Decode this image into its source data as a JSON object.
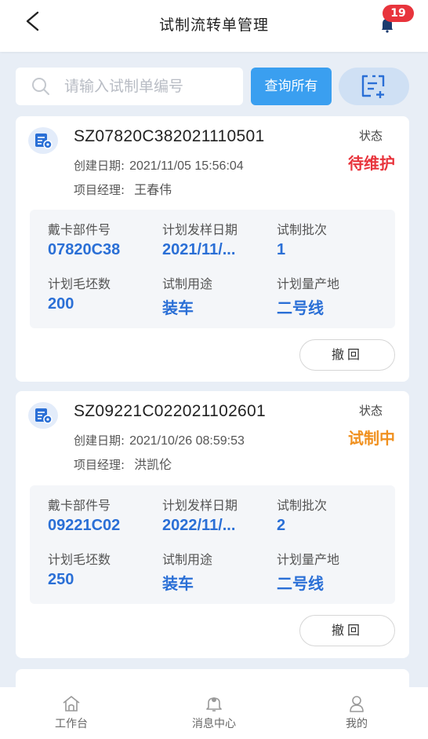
{
  "header": {
    "title": "试制流转单管理",
    "notification_count": "19"
  },
  "search": {
    "placeholder": "请输入试制单编号",
    "value": "",
    "query_all_label": "查询所有"
  },
  "colors": {
    "primary_blue": "#3a9ff0",
    "value_blue": "#2a6fd6",
    "status_pending": "#e8343c",
    "status_in_progress": "#f0901e",
    "badge_red": "#e8343c"
  },
  "labels": {
    "status": "状态",
    "created_date": "创建日期:",
    "project_manager": "项目经理:",
    "part_no": "戴卡部件号",
    "plan_sample_date": "计划发样日期",
    "trial_batch": "试制批次",
    "plan_blank_count": "计划毛坯数",
    "trial_purpose": "试制用途",
    "plan_production_site": "计划量产地",
    "withdraw": "撤回"
  },
  "orders": [
    {
      "order_no": "SZ07820C382021110501",
      "created_date": "2021/11/05 15:56:04",
      "project_manager": "王春伟",
      "status": "待维护",
      "part_no": "07820C38",
      "plan_sample_date": "2021/11/...",
      "trial_batch": "1",
      "plan_blank_count": "200",
      "trial_purpose": "装车",
      "plan_production_site": "二号线"
    },
    {
      "order_no": "SZ09221C022021102601",
      "created_date": "2021/10/26 08:59:53",
      "project_manager": "洪凯伦",
      "status": "试制中",
      "part_no": "09221C02",
      "plan_sample_date": "2022/11/...",
      "trial_batch": "2",
      "plan_blank_count": "250",
      "trial_purpose": "装车",
      "plan_production_site": "二号线"
    }
  ],
  "tabbar": {
    "items": [
      {
        "label": "工作台",
        "icon": "home-icon"
      },
      {
        "label": "消息中心",
        "icon": "bell-icon"
      },
      {
        "label": "我的",
        "icon": "user-icon"
      }
    ]
  }
}
